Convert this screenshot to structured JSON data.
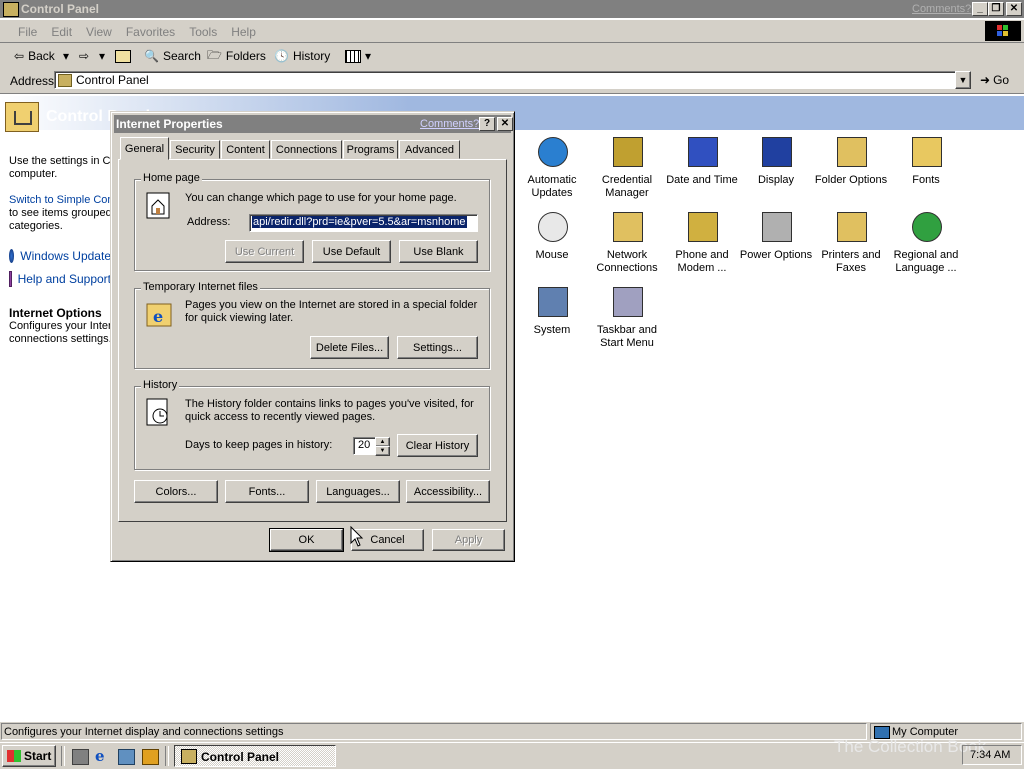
{
  "window": {
    "title": "Control Panel",
    "comments_link": "Comments?",
    "menu": [
      "File",
      "Edit",
      "View",
      "Favorites",
      "Tools",
      "Help"
    ],
    "toolbar": {
      "back": "Back",
      "search": "Search",
      "folders": "Folders",
      "history": "History"
    },
    "address": {
      "label": "Address",
      "value": "Control Panel",
      "go": "Go"
    }
  },
  "left_pane": {
    "header": "Control Panel",
    "intro": "Use the settings in Control Panel to personalize your computer.",
    "switch_link": "Switch to Simple Control Panel",
    "switch_text": "to see items grouped by categories.",
    "links": [
      "Windows Update",
      "Help and Support"
    ],
    "section_title": "Internet Options",
    "section_text": "Configures your Internet display and connections settings."
  },
  "icons": [
    {
      "label": "Automatic Updates",
      "icon": "globe-update-icon"
    },
    {
      "label": "Credential Manager",
      "icon": "keys-icon"
    },
    {
      "label": "Date and Time",
      "icon": "clock-calendar-icon"
    },
    {
      "label": "Display",
      "icon": "monitor-icon"
    },
    {
      "label": "Folder Options",
      "icon": "folder-tools-icon"
    },
    {
      "label": "Fonts",
      "icon": "fonts-folder-icon"
    },
    {
      "label": "Mouse",
      "icon": "mouse-icon"
    },
    {
      "label": "Network Connections",
      "icon": "network-folder-icon"
    },
    {
      "label": "Phone and Modem ...",
      "icon": "phone-icon"
    },
    {
      "label": "Power Options",
      "icon": "power-icon"
    },
    {
      "label": "Printers and Faxes",
      "icon": "printer-folder-icon"
    },
    {
      "label": "Regional and Language ...",
      "icon": "globe-icon"
    },
    {
      "label": "System",
      "icon": "computer-icon"
    },
    {
      "label": "Taskbar and Start Menu",
      "icon": "taskbar-icon"
    }
  ],
  "dialog": {
    "title": "Internet Properties",
    "comments_link": "Comments?",
    "tabs": [
      "General",
      "Security",
      "Content",
      "Connections",
      "Programs",
      "Advanced"
    ],
    "home_page": {
      "group_label": "Home page",
      "description": "You can change which page to use for your home page.",
      "address_label": "Address:",
      "address_value": "api/redir.dll?prd=ie&pver=5.5&ar=msnhome",
      "use_current": "Use Current",
      "use_default": "Use Default",
      "use_blank": "Use Blank"
    },
    "temp_files": {
      "group_label": "Temporary Internet files",
      "description": "Pages you view on the Internet are stored in a special folder for quick viewing later.",
      "delete_files": "Delete Files...",
      "settings": "Settings..."
    },
    "history": {
      "group_label": "History",
      "description": "The History folder contains links to pages you've visited, for quick access to recently viewed pages.",
      "days_label": "Days to keep pages in history:",
      "days_value": "20",
      "clear_history": "Clear History"
    },
    "bottom_buttons": [
      "Colors...",
      "Fonts...",
      "Languages...",
      "Accessibility..."
    ],
    "ok": "OK",
    "cancel": "Cancel",
    "apply": "Apply"
  },
  "status_bar": {
    "text": "Configures your Internet display and connections settings",
    "zone": "My Computer"
  },
  "taskbar": {
    "start": "Start",
    "task": "Control Panel",
    "clock": "7:34 AM",
    "watermark": "The Collection Book"
  }
}
